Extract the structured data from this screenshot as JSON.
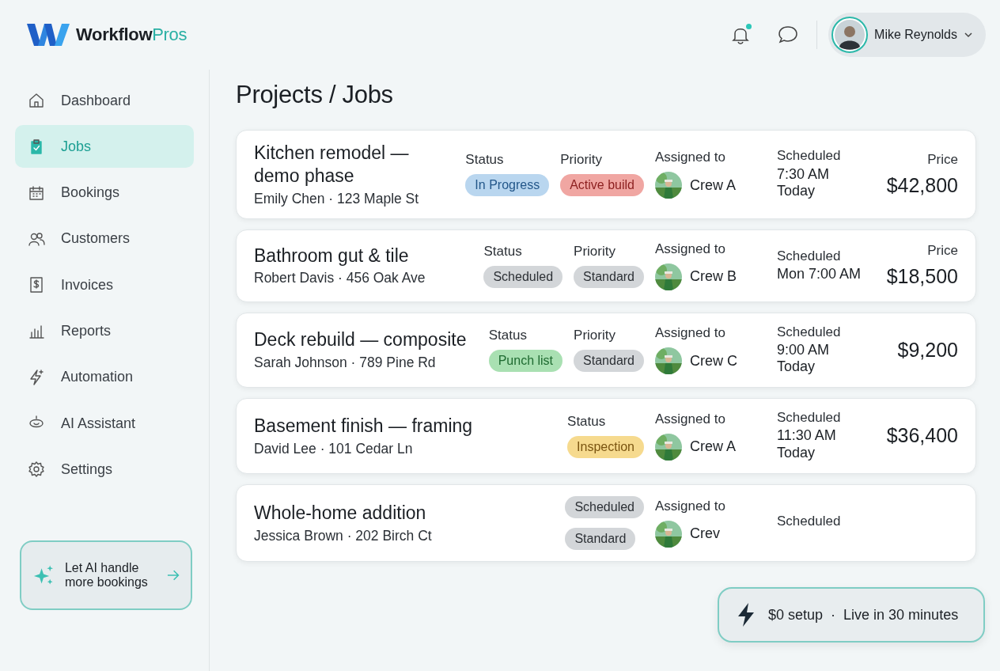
{
  "brand": {
    "name": "Workflow",
    "suffix": "Pros"
  },
  "header": {
    "user": {
      "name": "Mike Reynolds"
    }
  },
  "sidebar": {
    "items": [
      {
        "label": "Dashboard",
        "selected": false
      },
      {
        "label": "Jobs",
        "selected": true
      },
      {
        "label": "Bookings",
        "selected": false
      },
      {
        "label": "Customers",
        "selected": false
      },
      {
        "label": "Invoices",
        "selected": false
      },
      {
        "label": "Reports",
        "selected": false
      },
      {
        "label": "Automation",
        "selected": false
      },
      {
        "label": "AI Assistant",
        "selected": false
      },
      {
        "label": "Settings",
        "selected": false
      }
    ],
    "promo": {
      "text": "Let AI handle more bookings"
    }
  },
  "page_title": "Projects / Jobs",
  "jobs": [
    {
      "kind": "columns",
      "title": "Kitchen remodel — demo phase",
      "subtitle": "Emily Chen · 123 Maple St",
      "tags": [
        {
          "heading": "Status",
          "label": "In Progress",
          "color": "#b9d6ef"
        },
        {
          "heading": "Priority",
          "label": "Active build",
          "color": "#f0a6a2"
        }
      ],
      "assigned": {
        "heading": "Assigned to",
        "crew": "Crew A"
      },
      "schedule": {
        "heading": "Scheduled",
        "lines": [
          "7:30 AM",
          "Today"
        ]
      },
      "price": {
        "heading": "Price",
        "value": "$42,800"
      }
    },
    {
      "kind": "columns",
      "title": "Bathroom gut & tile",
      "subtitle": "Robert Davis · 456 Oak Ave",
      "tags": [
        {
          "heading": "Status",
          "label": "Scheduled",
          "color": "#d3d6d9"
        },
        {
          "heading": "Priority",
          "label": "Standard",
          "color": "#d3d6d9"
        }
      ],
      "assigned": {
        "heading": "Assigned to",
        "crew": "Crew B"
      },
      "schedule": {
        "heading": "Scheduled",
        "lines": [
          "Mon 7:00 AM"
        ]
      },
      "price": {
        "heading": "Price",
        "value": "$18,500"
      }
    },
    {
      "kind": "columns",
      "title": "Deck rebuild — composite",
      "subtitle": "Sarah Johnson · 789 Pine Rd",
      "tags": [
        {
          "heading": "Status",
          "label": "Punch list",
          "color": "#a9e0b2"
        },
        {
          "heading": "Priority",
          "label": "Standard",
          "color": "#d3d6d9"
        }
      ],
      "assigned": {
        "heading": "Assigned to",
        "crew": "Crew C"
      },
      "schedule": {
        "heading": "Scheduled",
        "lines": [
          "9:00 AM",
          "Today"
        ]
      },
      "price": {
        "value": "$9,200"
      }
    },
    {
      "kind": "columns",
      "title": "Basement finish — framing",
      "subtitle": "David Lee · 101 Cedar Ln",
      "tags": [
        {
          "heading": "Status",
          "label": "Inspection",
          "color": "#f6da8e"
        }
      ],
      "assigned": {
        "heading": "Assigned to",
        "crew": "Crew A"
      },
      "schedule": {
        "heading": "Scheduled",
        "lines": [
          "11:30 AM",
          "Today"
        ]
      },
      "price": {
        "value": "$36,400"
      }
    },
    {
      "kind": "stacked",
      "title": "Whole-home addition",
      "subtitle": "Jessica Brown · 202 Birch Ct",
      "tags": [
        {
          "label": "Scheduled",
          "color": "#d3d6d9"
        },
        {
          "label": "Standard",
          "color": "#d3d6d9"
        }
      ],
      "assigned": {
        "heading": "Assigned to",
        "crew": "Crev"
      },
      "schedule": {
        "heading": "Scheduled"
      }
    }
  ],
  "toast": {
    "primary": "$0 setup",
    "separator": "·",
    "secondary": "Live in 30 minutes"
  }
}
